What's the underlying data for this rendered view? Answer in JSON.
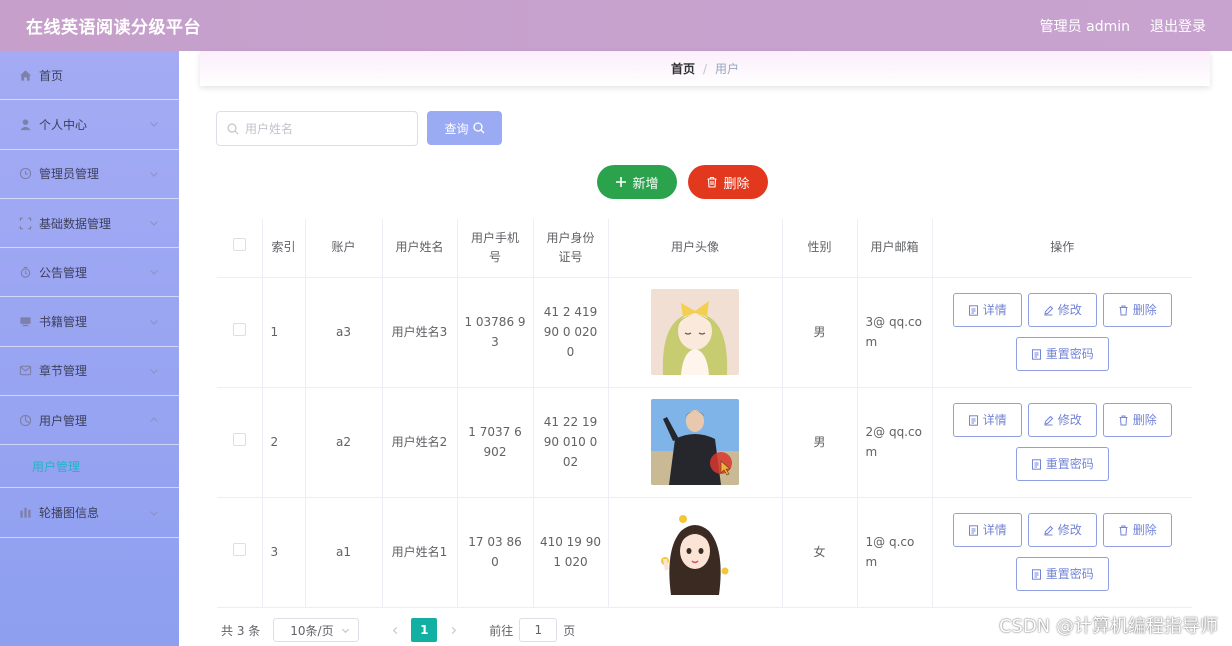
{
  "header": {
    "title": "在线英语阅读分级平台",
    "user": "管理员 admin",
    "logout": "退出登录"
  },
  "sidebar": {
    "items": [
      {
        "label": "首页",
        "icon": "home-icon"
      },
      {
        "label": "个人中心",
        "icon": "user-icon"
      },
      {
        "label": "管理员管理",
        "icon": "admin-icon"
      },
      {
        "label": "基础数据管理",
        "icon": "data-icon"
      },
      {
        "label": "公告管理",
        "icon": "notice-icon"
      },
      {
        "label": "书籍管理",
        "icon": "book-icon"
      },
      {
        "label": "章节管理",
        "icon": "chapter-icon"
      },
      {
        "label": "用户管理",
        "icon": "users-icon"
      },
      {
        "label": "轮播图信息",
        "icon": "carousel-icon"
      }
    ],
    "active_sub": "用户管理"
  },
  "breadcrumb": {
    "home": "首页",
    "separator": "/",
    "current": "用户"
  },
  "search": {
    "placeholder": "用户姓名",
    "button": "查询"
  },
  "actions": {
    "add": "新增",
    "delete": "删除"
  },
  "table": {
    "headers": [
      "索引",
      "账户",
      "用户姓名",
      "用户手机号",
      "用户身份证号",
      "用户头像",
      "性别",
      "用户邮箱",
      "操作"
    ],
    "rows": [
      {
        "index": "1",
        "account": "a3",
        "name": "用户姓名3",
        "phone": "1 03786 9 3",
        "id_card": "41 2 419 90 0 020 0",
        "avatar": "anime-girl-yellow-bow",
        "gender": "男",
        "email": "3@ qq.co m"
      },
      {
        "index": "2",
        "account": "a2",
        "name": "用户姓名2",
        "phone": "1 7037 6 902",
        "id_card": "41 22 19 90 010 0 02",
        "avatar": "man-outdoor-photo",
        "gender": "男",
        "email": "2@ qq.co m"
      },
      {
        "index": "3",
        "account": "a1",
        "name": "用户姓名1",
        "phone": "17 03 86 0",
        "id_card": "410 19 901 020",
        "avatar": "cartoon-girl-waving",
        "gender": "女",
        "email": "1@ q.co m"
      }
    ],
    "row_actions": {
      "detail": "详情",
      "edit": "修改",
      "delete": "删除",
      "reset": "重置密码"
    }
  },
  "pagination": {
    "total": "共 3 条",
    "page_size": "10条/页",
    "current_page": "1",
    "goto_label": "前往",
    "goto_value": "1",
    "page_suffix": "页"
  },
  "watermark": "CSDN @计算机编程指导师",
  "colors": {
    "header": "#c7a1cd",
    "sidebar": "#9aa6f2",
    "active_menu": "#1fb5c7",
    "add": "#2ba24c",
    "delete": "#e2391e",
    "page_active": "#12b0a2",
    "query": "#9aaaf3"
  }
}
